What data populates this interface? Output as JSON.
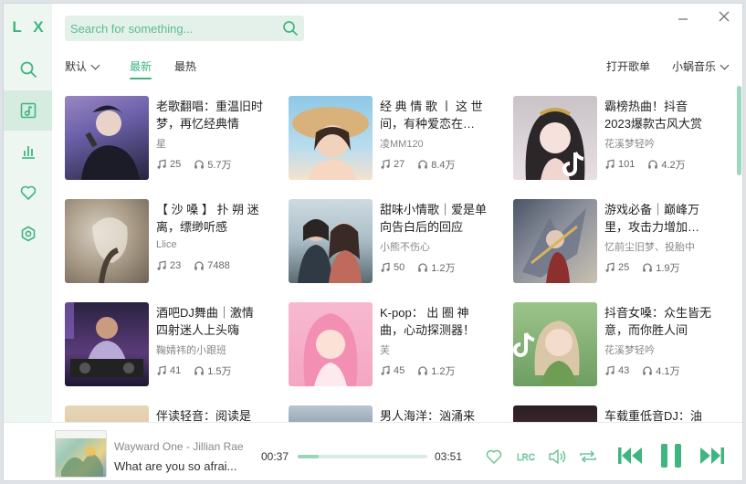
{
  "app": {
    "logo": "L X"
  },
  "sidebar": {
    "items": [
      {
        "icon": "search-icon"
      },
      {
        "icon": "playlist-icon",
        "active": true
      },
      {
        "icon": "chart-icon"
      },
      {
        "icon": "heart-icon"
      },
      {
        "icon": "settings-icon"
      }
    ]
  },
  "search": {
    "placeholder": "Search for something..."
  },
  "filters": {
    "sort_default": "默认",
    "tab_newest": "最新",
    "tab_hottest": "最热",
    "open_playlist": "打开歌单",
    "source": "小蜗音乐"
  },
  "playlists": [
    {
      "title": "老歌翻唱：重温旧时梦，再忆经典情",
      "author": "星",
      "songs": "25",
      "plays": "5.7万"
    },
    {
      "title": "经 典 情 歌 丨 这 世 间，有种爱恋在…",
      "author": "凌MM120",
      "songs": "27",
      "plays": "8.4万"
    },
    {
      "title": "霸榜热曲！抖音2023爆款古风大赏",
      "author": "花溪梦轻吟",
      "songs": "101",
      "plays": "4.2万"
    },
    {
      "title": "【 沙 嗓 】 扑 朔 迷 离，缥缈听感",
      "author": "Llice",
      "songs": "23",
      "plays": "7488"
    },
    {
      "title": "甜味小情歌｜爱是单向告白后的回应",
      "author": "小熊不伤心",
      "songs": "50",
      "plays": "1.2万"
    },
    {
      "title": "游戏必备｜巅峰万里，攻击力增加…",
      "author": "忆前尘旧梦、投胎中",
      "songs": "25",
      "plays": "1.9万"
    },
    {
      "title": "酒吧DJ舞曲｜激情四射迷人上头嗨",
      "author": "鞠婧祎的小跟班",
      "songs": "41",
      "plays": "1.5万"
    },
    {
      "title": "K-pop： 出 圈 神 曲，心动探测器！",
      "author": "芙",
      "songs": "45",
      "plays": "1.2万"
    },
    {
      "title": "抖音女嗓：众生皆无意，而你胜人间",
      "author": "花溪梦轻吟",
      "songs": "43",
      "plays": "4.1万"
    },
    {
      "title": "伴读轻音：阅读是",
      "author": "",
      "songs": "",
      "plays": ""
    },
    {
      "title": "男人海洋：汹涌来",
      "author": "",
      "songs": "",
      "plays": ""
    },
    {
      "title": "车载重低音DJ：油",
      "author": "",
      "songs": "",
      "plays": ""
    }
  ],
  "player": {
    "song": "Wayward One - Jillian Rae",
    "lyric": "What are you so afrai...",
    "current_time": "00:37",
    "total_time": "03:51",
    "progress": 0.16,
    "lyric_badge": "LRC",
    "accent": "#3fb680"
  },
  "colors": {
    "accent": "#3fb680",
    "sidebar_bg": "#eef6f2"
  }
}
